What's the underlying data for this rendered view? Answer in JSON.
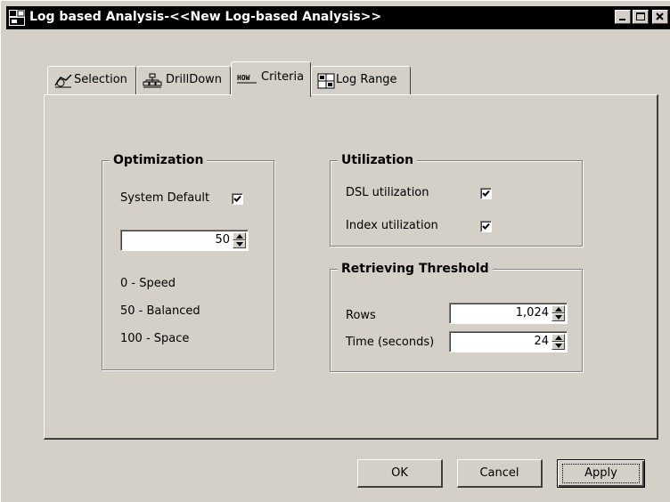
{
  "window": {
    "title": "Log based Analysis-<<New Log-based Analysis>>",
    "controls": [
      "minimize-icon",
      "maximize-icon",
      "close-icon"
    ]
  },
  "tabs": [
    {
      "label": "Selection",
      "icon": "selection-icon",
      "active": false
    },
    {
      "label": "DrillDown",
      "icon": "drilldown-icon",
      "active": false
    },
    {
      "label": "Criteria",
      "icon": "criteria-icon",
      "active": true
    },
    {
      "label": "Log Range",
      "icon": "log-range-icon",
      "active": false
    }
  ],
  "optimization": {
    "title": "Optimization",
    "system_default_label": "System Default",
    "system_default_checked": true,
    "value": "50",
    "legend": [
      "0 - Speed",
      "50 - Balanced",
      "100 - Space"
    ]
  },
  "utilization": {
    "title": "Utilization",
    "dsl_label": "DSL utilization",
    "dsl_checked": true,
    "index_label": "Index utilization",
    "index_checked": true
  },
  "threshold": {
    "title": "Retrieving Threshold",
    "rows_label": "Rows",
    "rows_value": "1,024",
    "time_label": "Time (seconds)",
    "time_value": "24"
  },
  "buttons": {
    "ok": "OK",
    "cancel": "Cancel",
    "apply": "Apply"
  }
}
